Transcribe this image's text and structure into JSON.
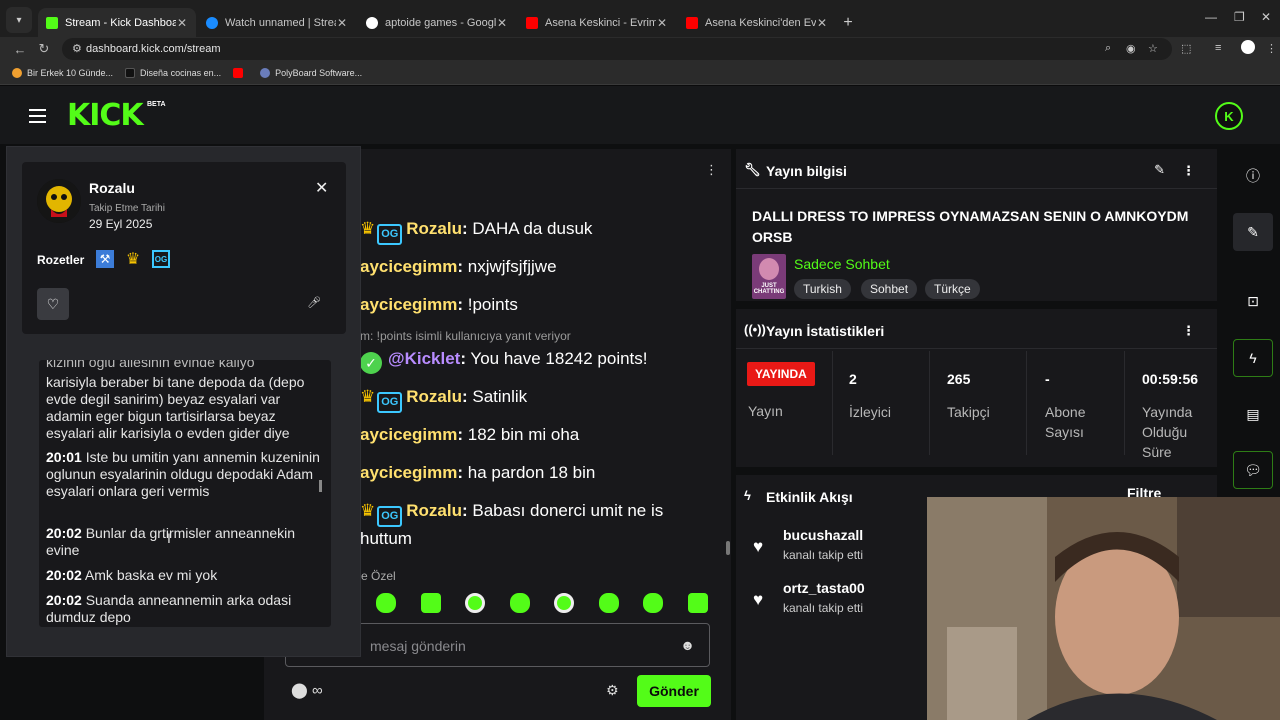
{
  "browser": {
    "tabs": [
      {
        "title": "Stream - Kick Dashboard",
        "color": "#53fc18",
        "active": true
      },
      {
        "title": "Watch unnamed | Streamable",
        "color": "#1a8cff",
        "active": false
      },
      {
        "title": "aptoide games - Google'da Ara",
        "color": "#ffffff",
        "active": false
      },
      {
        "title": "Asena Keskinci - Evrim Akın Ol",
        "color": "#ff0000",
        "active": false
      },
      {
        "title": "Asena Keskinci'den Evrim Akın",
        "color": "#ff0000",
        "active": false
      }
    ],
    "url": "dashboard.kick.com/stream",
    "bookmarks": [
      {
        "label": "Bir Erkek 10 Günde...",
        "color": "#f0a030"
      },
      {
        "label": "Diseña cocinas en...",
        "color": "#111111"
      },
      {
        "label": "",
        "color": "#ff0000"
      },
      {
        "label": "PolyBoard Software...",
        "color": "#6a7dbb"
      }
    ]
  },
  "header": {
    "logo": "KICK",
    "beta": "BETA",
    "icon_letter": "K"
  },
  "chat": {
    "messages": [
      {
        "user": "Rozalu",
        "text": " DAHA da dusuk"
      },
      {
        "user": "aycicegimm",
        "text": " nxjwjfsjfjjwe"
      },
      {
        "user": "aycicegimm",
        "text": " !points"
      },
      {
        "user": "@Kicklet",
        "text": " You have 18242 points!"
      },
      {
        "user": "Rozalu",
        "text": " Satinlik"
      },
      {
        "user": "aycicegimm",
        "text": " 182 bin mi oha"
      },
      {
        "user": "aycicegimm",
        "text": " ha pardon 18 bin"
      },
      {
        "user": "Rozalu",
        "text": " Babası donerci umit ne is"
      }
    ],
    "reply_note": "m: !points isimli kullanıcıya yanıt veriyor",
    "continuation": "huttum",
    "emote_label": "e Özel",
    "input_placeholder": "mesaj gönderin",
    "infinity": "∞",
    "send_label": "Gönder"
  },
  "user_card": {
    "name": "Rozalu",
    "follow_label": "Takip Etme Tarihi",
    "follow_date": "29 Eyl 2025",
    "badges_label": "Rozetler",
    "history": [
      {
        "time": "",
        "text": "kizinin oglu ailesinin evinde kaliyo"
      },
      {
        "time": "",
        "text": "karisiyla beraber bi tane depoda da (depo evde degil sanirim) beyaz esyalari var adamin eger bigun tartisirlarsa beyaz esyalari alir karisiyla o evden gider diye"
      },
      {
        "time": "20:01",
        "text": " Iste bu umitin yanı annemin kuzeninin oglunun esyalarinin oldugu depodaki Adam esyalari onlara geri vermis"
      },
      {
        "time": "20:02",
        "text": " Bunlar da grtirmisler anneannekin evine"
      },
      {
        "time": "20:02",
        "text": " Amk baska ev mi yok"
      },
      {
        "time": "20:02",
        "text": " Suanda anneannemin arka odasi dumduz depo"
      }
    ]
  },
  "stream_info": {
    "title": "Yayın bilgisi",
    "stream_title": "DALLI DRESS TO IMPRESS OYNAMAZSAN SENIN O AMNKOYDM ORSB",
    "category": "Sadece Sohbet",
    "category_thumb": "JUST CHATTING",
    "tags": [
      "Turkish",
      "Sohbet",
      "Türkçe"
    ]
  },
  "stats": {
    "title": "Yayın İstatistikleri",
    "live_badge": "YAYINDA",
    "live_label": "Yayın",
    "viewers": "2",
    "viewers_label": "İzleyici",
    "followers": "265",
    "followers_label": "Takipçi",
    "subs": "-",
    "subs_label": "Abone Sayısı",
    "duration": "00:59:56",
    "duration_label": "Yayında Olduğu Süre"
  },
  "events": {
    "title": "Etkinlik Akışı",
    "filter": "Filtre",
    "items": [
      {
        "name": "bucushazall",
        "action": "kanalı takip etti"
      },
      {
        "name": "ortz_tasta00",
        "action": "kanalı takip etti"
      }
    ]
  },
  "colors": {
    "accent": "#53fc18",
    "live": "#e91916",
    "panel": "#18181b"
  }
}
